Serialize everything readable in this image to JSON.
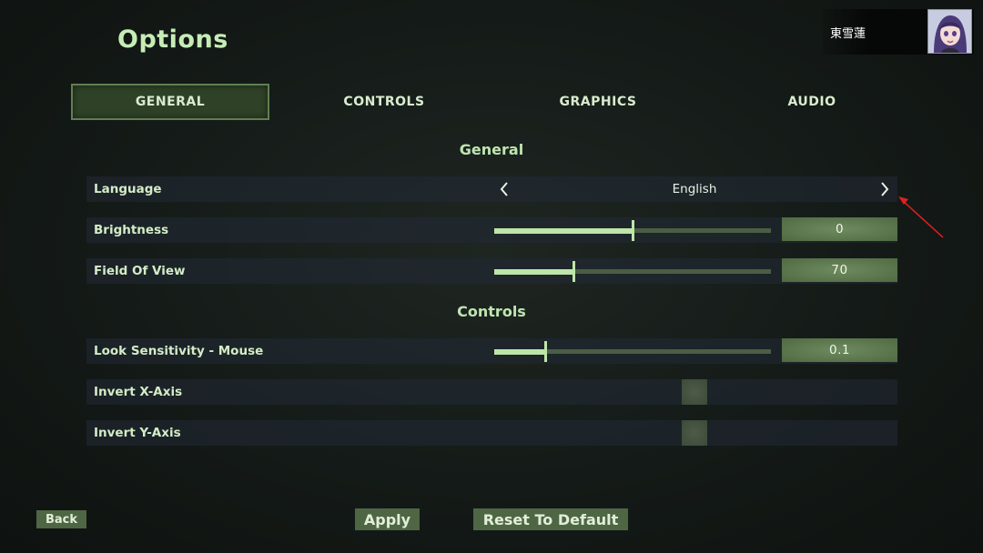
{
  "page": {
    "title": "Options"
  },
  "user": {
    "name": "東雪蓮",
    "avatar_icon": "user-avatar"
  },
  "tabs": [
    {
      "label": "GENERAL",
      "active": true
    },
    {
      "label": "CONTROLS",
      "active": false
    },
    {
      "label": "GRAPHICS",
      "active": false
    },
    {
      "label": "AUDIO",
      "active": false
    }
  ],
  "sections": {
    "general": {
      "title": "General",
      "language": {
        "label": "Language",
        "value": "English",
        "prev_icon": "chevron-left-icon",
        "next_icon": "chevron-right-icon"
      },
      "brightness": {
        "label": "Brightness",
        "value": "0",
        "slider_fraction": 0.5
      },
      "fov": {
        "label": "Field Of View",
        "value": "70",
        "slider_fraction": 0.285
      }
    },
    "controls": {
      "title": "Controls",
      "sensitivity": {
        "label": "Look Sensitivity - Mouse",
        "value": "0.1",
        "slider_fraction": 0.185
      },
      "invert_x": {
        "label": "Invert X-Axis",
        "checked": false
      },
      "invert_y": {
        "label": "Invert Y-Axis",
        "checked": false
      }
    }
  },
  "footer": {
    "back_label": "Back",
    "apply_label": "Apply",
    "reset_label": "Reset To Default"
  },
  "colors": {
    "accent": "#bde6a8",
    "active_tab": "#2f4227",
    "button": "#4e6644",
    "annotation_arrow": "#e0201e"
  }
}
